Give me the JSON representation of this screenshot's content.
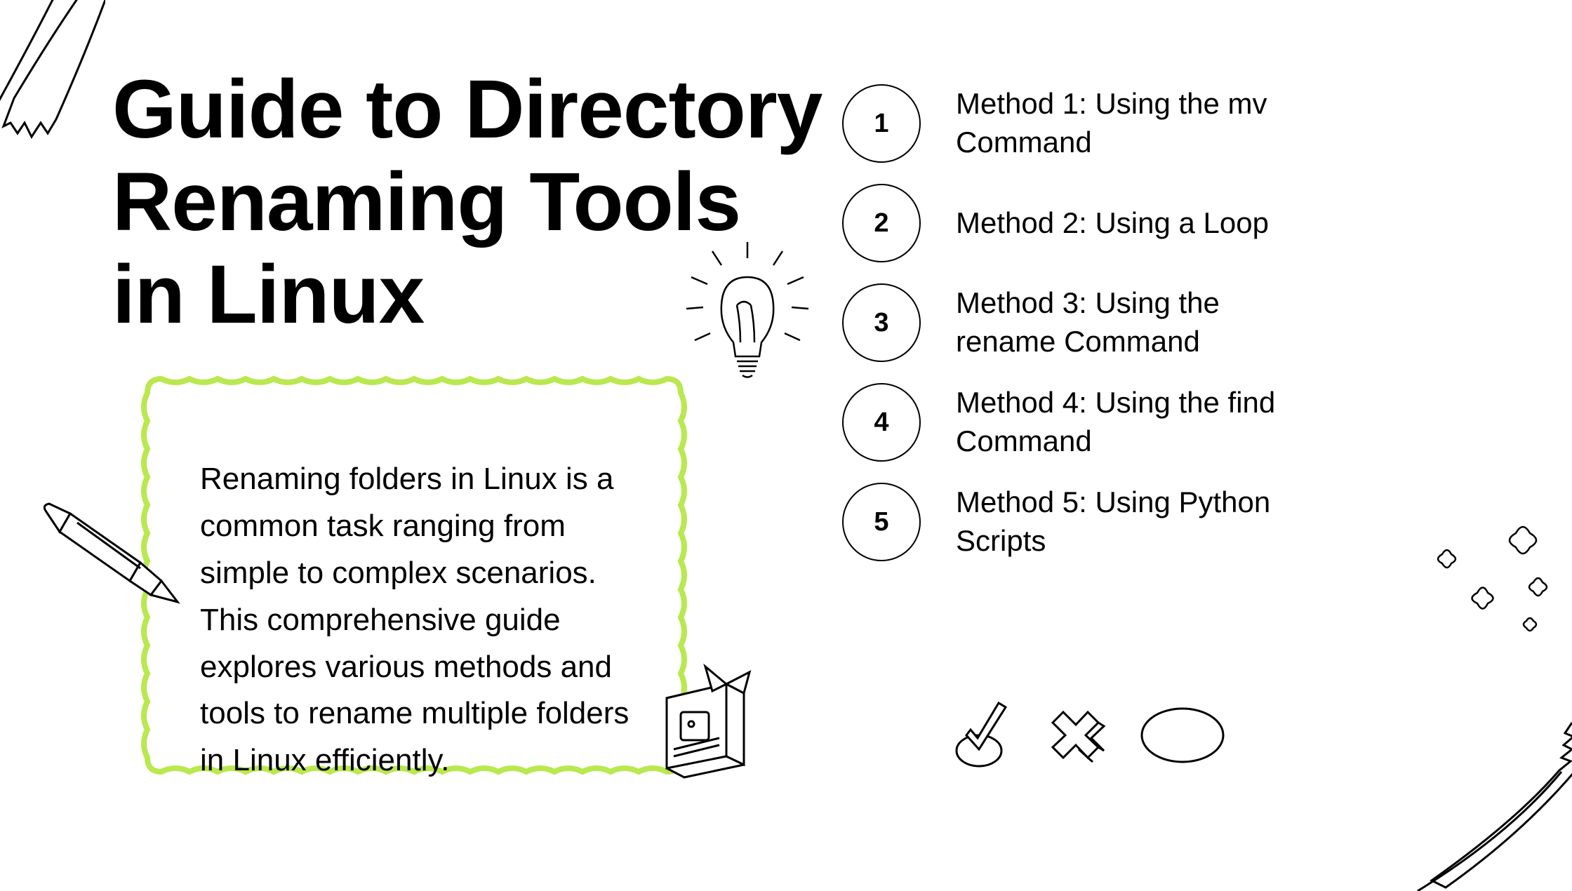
{
  "title": "Guide to Directory Renaming Tools in Linux",
  "description": "Renaming folders in Linux is a common task ranging from simple to complex scenarios. This comprehensive guide explores various methods and tools to rename multiple folders in Linux efficiently.",
  "methods": [
    {
      "number": "1",
      "label": "Method 1: Using the mv Command"
    },
    {
      "number": "2",
      "label": "Method 2: Using a Loop"
    },
    {
      "number": "3",
      "label": "Method 3: Using the rename Command"
    },
    {
      "number": "4",
      "label": "Method 4: Using the find Command"
    },
    {
      "number": "5",
      "label": "Method 5: Using Python Scripts"
    }
  ],
  "colors": {
    "accent": "#b9e84f",
    "text": "#000000",
    "bg": "#ffffff"
  }
}
